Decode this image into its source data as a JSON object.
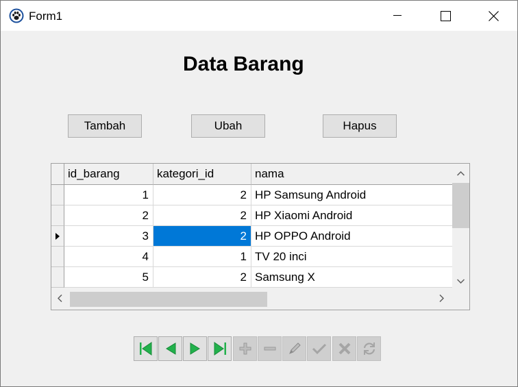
{
  "window": {
    "title": "Form1",
    "icons": [
      "app-paw-icon",
      "minimize-icon",
      "maximize-icon",
      "close-icon"
    ]
  },
  "heading": "Data Barang",
  "buttons": {
    "add": "Tambah",
    "edit": "Ubah",
    "delete": "Hapus"
  },
  "grid": {
    "columns": [
      "id_barang",
      "kategori_id",
      "nama"
    ],
    "rows": [
      {
        "id_barang": "1",
        "kategori_id": "2",
        "nama": "HP Samsung Android"
      },
      {
        "id_barang": "2",
        "kategori_id": "2",
        "nama": "HP Xiaomi Android"
      },
      {
        "id_barang": "3",
        "kategori_id": "2",
        "nama": "HP OPPO Android"
      },
      {
        "id_barang": "4",
        "kategori_id": "1",
        "nama": "TV 20 inci"
      },
      {
        "id_barang": "5",
        "kategori_id": "2",
        "nama": "Samsung X"
      }
    ],
    "current_row": 3,
    "selected_cell": "kategori_id",
    "selection_color": "#0078d7"
  },
  "navigator": {
    "buttons": [
      "first-icon",
      "prior-icon",
      "next-icon",
      "last-icon",
      "insert-icon",
      "delete-icon",
      "edit-icon",
      "post-icon",
      "cancel-icon",
      "refresh-icon"
    ],
    "enabled": [
      true,
      true,
      true,
      true,
      false,
      false,
      false,
      false,
      false,
      false
    ],
    "accent_color": "#22b14c"
  }
}
